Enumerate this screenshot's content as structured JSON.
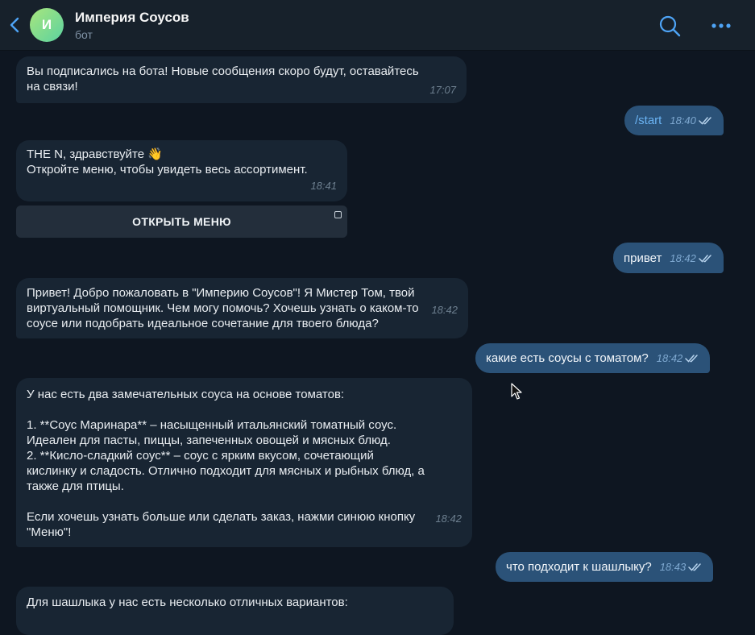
{
  "header": {
    "back_icon": "chevron-left-icon",
    "avatar_letter": "И",
    "title": "Империя Соусов",
    "subtitle": "бот",
    "search_icon": "search-icon",
    "more_icon": "more-dots-icon"
  },
  "messages": [
    {
      "dir": "in",
      "text": "Вы подписались на бота! Новые сообщения скоро будут, оставайтесь\nна связи!",
      "time": "17:07"
    },
    {
      "dir": "out",
      "text": "/start",
      "time": "18:40"
    },
    {
      "dir": "in",
      "text": "THE N, здравствуйте 👋\nОткройте меню, чтобы увидеть весь ассортимент.",
      "time": "18:41"
    },
    {
      "dir": "out",
      "text": "привет",
      "time": "18:42"
    },
    {
      "dir": "in",
      "text": "Привет! Добро пожаловать в \"Империю Соусов\"! Я Мистер Том, твой\nвиртуальный помощник. Чем могу помочь? Хочешь узнать о каком-то\nсоусе или подобрать идеальное сочетание для твоего блюда?",
      "time": "18:42"
    },
    {
      "dir": "out",
      "text": "какие есть соусы с томатом?",
      "time": "18:42"
    },
    {
      "dir": "in",
      "text": "У нас есть два замечательных соуса на основе томатов:\n\n1. **Соус Маринара** – насыщенный итальянский томатный соус.\nИдеален для пасты, пиццы, запеченных овощей и мясных блюд.\n2. **Кисло-сладкий соус** – соус с ярким вкусом, сочетающий\nкислинку и сладость. Отлично подходит для мясных и рыбных блюд, а\nтакже для птицы.\n\nЕсли хочешь узнать больше или сделать заказ, нажми синюю кнопку\n\"Меню\"!",
      "time": "18:42"
    },
    {
      "dir": "out",
      "text": "что подходит к шашлыку?",
      "time": "18:43"
    },
    {
      "dir": "in",
      "text": "Для шашлыка у нас есть несколько отличных вариантов:",
      "time": ""
    }
  ],
  "keyboard": {
    "open_menu_label": "ОТКРЫТЬ МЕНЮ"
  },
  "colors": {
    "background": "#0e1621",
    "incoming": "#182533",
    "outgoing": "#2b5278",
    "accent": "#6ab3f3"
  }
}
